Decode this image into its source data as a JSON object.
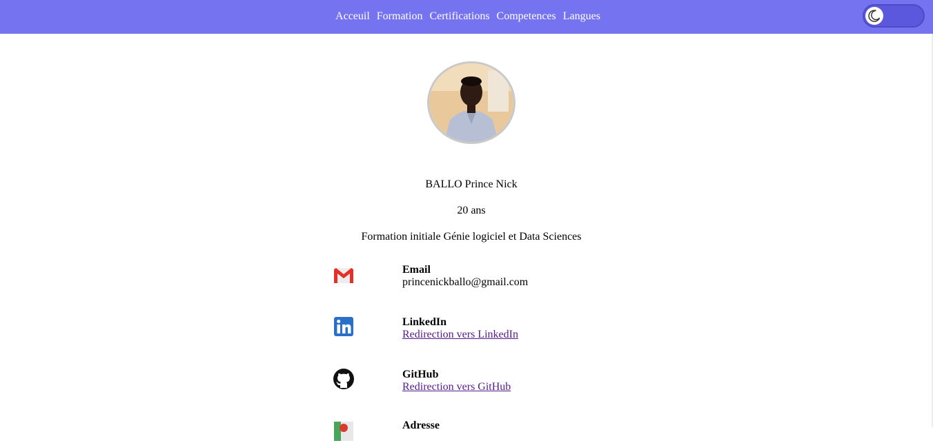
{
  "nav": {
    "links": [
      "Acceuil",
      "Formation",
      "Certifications",
      "Competences",
      "Langues"
    ]
  },
  "theme_toggle": {
    "icon": "moon-icon"
  },
  "profile": {
    "name": "BALLO Prince Nick",
    "age": "20 ans",
    "program": "Formation initiale Génie logiciel et Data Sciences"
  },
  "contacts": [
    {
      "icon": "gmail-icon",
      "label": "Email",
      "value": "princenickballo@gmail.com"
    },
    {
      "icon": "linkedin-icon",
      "label": "LinkedIn",
      "link_text": "Redirection vers LinkedIn"
    },
    {
      "icon": "github-icon",
      "label": "GitHub",
      "link_text": "Redirection vers GitHub"
    },
    {
      "icon": "map-pin-icon",
      "label": "Adresse"
    }
  ],
  "colors": {
    "navbar": "#7673f0",
    "toggle": "#5b58dd",
    "link_visited": "#551a8b"
  }
}
